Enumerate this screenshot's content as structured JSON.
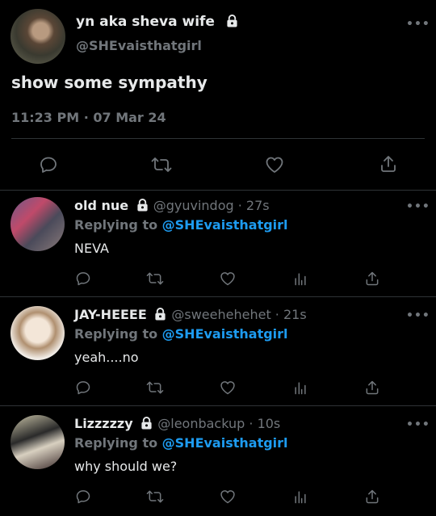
{
  "main_tweet": {
    "display_name": "yn aka sheva wife",
    "handle": "@SHEvaisthatgirl",
    "text": "show some sympathy",
    "timestamp": "11:23 PM · 07 Mar 24",
    "more": "•••",
    "actions": [
      "reply-icon",
      "retweet-icon",
      "like-icon",
      "share-icon"
    ]
  },
  "replies": [
    {
      "display_name": "old nue",
      "handle": "@gyuvindog",
      "sep": " · ",
      "time": "27s",
      "replying_prefix": "Replying to ",
      "replying_to": "@SHEvaisthatgirl",
      "text": "NEVA",
      "more": "•••"
    },
    {
      "display_name": "JAY-HEEEE",
      "handle": "@sweehehehet",
      "sep": " · ",
      "time": "21s",
      "replying_prefix": "Replying to ",
      "replying_to": "@SHEvaisthatgirl",
      "text": "yeah....no",
      "more": "•••"
    },
    {
      "display_name": "Lizzzzzy",
      "handle": "@leonbackup",
      "sep": " · ",
      "time": "10s",
      "replying_prefix": "Replying to ",
      "replying_to": "@SHEvaisthatgirl",
      "text": "why should we?",
      "more": "•••"
    }
  ],
  "colors": {
    "background": "#000000",
    "text": "#e7e9ea",
    "secondary": "#71767b",
    "link": "#1d9bf0",
    "divider": "#2f3336"
  }
}
